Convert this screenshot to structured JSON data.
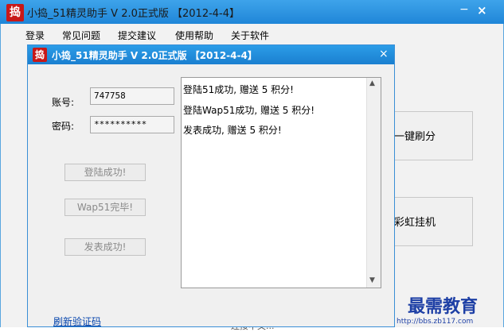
{
  "main_window": {
    "title": "小捣_51精灵助手    V 2.0正式版 【2012-4-4】",
    "logo_text": "捣",
    "min_glyph": "−",
    "close_glyph": "×",
    "menu": [
      "登录",
      "常见问题",
      "提交建议",
      "使用帮助",
      "关于软件"
    ],
    "buttons": {
      "one_click": "一键刷分",
      "rainbow": "彩虹挂机"
    },
    "bottom_text": "连接中文..."
  },
  "dialog": {
    "title": "小捣_51精灵助手    V 2.0正式版 【2012-4-4】",
    "logo_text": "捣",
    "close_glyph": "×",
    "account_label": "账号:",
    "account_value": "747758",
    "password_label": "密码:",
    "password_value": "**********",
    "btn_login": "登陆成功!",
    "btn_wap": "Wap51完毕!",
    "btn_post": "发表成功!",
    "log_lines": [
      "登陆51成功, 赠送 5 积分!",
      "登陆Wap51成功, 赠送 5 积分!",
      "发表成功, 赠送 5 积分!"
    ],
    "scroll_up": "▲",
    "scroll_down": "▼",
    "refresh_link": "刷新验证码"
  },
  "watermark": {
    "text": "最需教育",
    "url": "http://bbs.zb117.com"
  },
  "colors": {
    "titlebar": "#1f86d8",
    "dialog_titlebar": "#1a7fd0",
    "link": "#0645ad",
    "watermark": "#1d3fa5",
    "logo": "#c81818"
  }
}
